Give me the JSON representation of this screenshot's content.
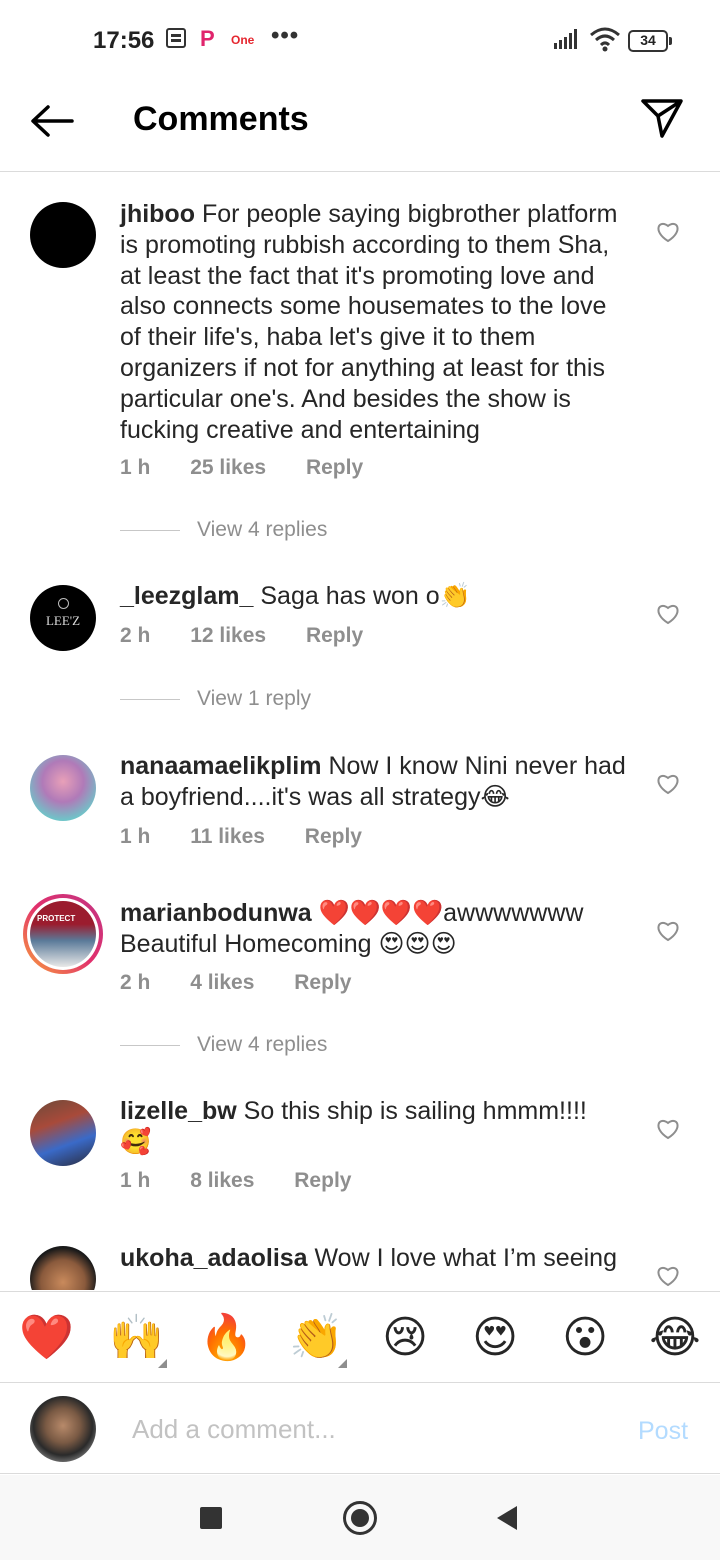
{
  "status_bar": {
    "time": "17:56",
    "p_label": "P",
    "one_label": "One",
    "dots": "•••",
    "battery": "34"
  },
  "header": {
    "title": "Comments"
  },
  "comments": [
    {
      "username": "jhiboo",
      "text": "For people saying bigbrother platform is promoting rubbish according to them Sha, at least the fact that it's promoting love and also connects some housemates to the love of their life's, haba let's give it to them organizers if not for anything at least for this particular one's. And besides the show is fucking creative and entertaining",
      "time": "1 h",
      "likes": "25 likes",
      "reply": "Reply",
      "view_replies": "View 4 replies"
    },
    {
      "username": "_leezglam_",
      "text": "Saga has won o",
      "emoji": "👏",
      "avatar_text": "LEE'Z",
      "time": "2 h",
      "likes": "12 likes",
      "reply": "Reply",
      "view_replies": "View 1 reply"
    },
    {
      "username": "nanaamaelikplim",
      "text": "Now I know Nini never had a boyfriend....it's was all strategy",
      "emoji": "😂",
      "time": "1 h",
      "likes": "11 likes",
      "reply": "Reply"
    },
    {
      "username": "marianbodunwa",
      "text_before": "❤️❤️❤️❤️",
      "text": "awwwwwww Beautiful Homecoming",
      "emoji": "😍😍😍",
      "avatar_text": "PROTECT",
      "time": "2 h",
      "likes": "4 likes",
      "reply": "Reply",
      "view_replies": "View 4 replies"
    },
    {
      "username": "lizelle_bw",
      "text": "So this ship is sailing hmmm!!!!",
      "emoji": "🥰",
      "time": "1 h",
      "likes": "8 likes",
      "reply": "Reply"
    },
    {
      "username": "ukoha_adaolisa",
      "text": "Wow I love what I’m seeing"
    }
  ],
  "reactions": [
    "❤️",
    "🙌",
    "🔥",
    "👏",
    "😢",
    "😍",
    "😮",
    "😂"
  ],
  "composer": {
    "placeholder": "Add a comment...",
    "post_label": "Post"
  },
  "colors": {
    "text": "#262626",
    "muted": "#8e8e8e",
    "post_disabled": "#b3dbff",
    "divider": "#dbdbdb"
  }
}
